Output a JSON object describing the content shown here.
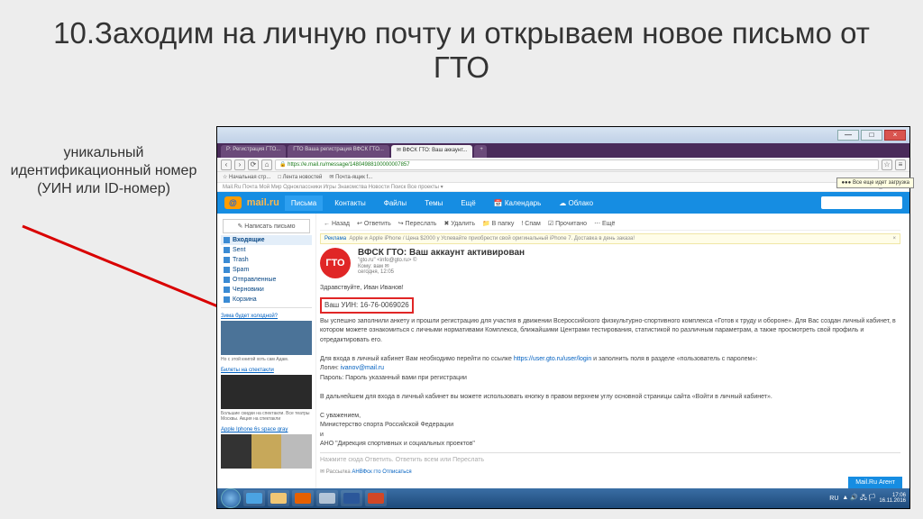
{
  "slide": {
    "title": "10.Заходим на личную почту и открываем новое письмо от ГТО",
    "caption": "уникальный идентификационный номер\n(УИН или ID-номер)"
  },
  "window": {
    "min": "—",
    "max": "□",
    "close": "×"
  },
  "browser": {
    "tabs": [
      "Р: Регистрация ГТО...",
      "ГТО Ваша регистрация ВФСК ГТО...",
      "✉ ВФСК ГТО: Ваш аккаунт...",
      "+"
    ],
    "url": "https://e.mail.ru/message/14804988100000007857",
    "nav": {
      "back": "‹",
      "fwd": "›",
      "reload": "⟳",
      "home": "⌂",
      "star": "☆",
      "menu": "≡"
    },
    "bookmarks": [
      "☆ Начальная стр...",
      "□ Лента новостей",
      "✉ Почта-ящик f..."
    ],
    "account": "t●●●f4@mail.ru ▾",
    "subbar_left": "Mail.Ru  Почта  Мой Мир  Одноклассники  Игры  Знакомства  Новости  Поиск  Все проекты ▾"
  },
  "mail": {
    "logo": "@",
    "logotext": "mail.ru",
    "tooltip": "●●● Все еще идет загрузка",
    "tabs": [
      "Письма",
      "Контакты",
      "Файлы",
      "Темы",
      "Ещё"
    ],
    "right": [
      "📅 Календарь",
      "☁ Облако"
    ],
    "compose": "✎ Написать письмо",
    "folders": [
      {
        "label": "Входящие",
        "act": true
      },
      {
        "label": "Sent"
      },
      {
        "label": "Trash"
      },
      {
        "label": "Spam"
      },
      {
        "label": "Отправленные"
      },
      {
        "label": "Черновики"
      },
      {
        "label": "Корзина"
      }
    ],
    "ads": [
      {
        "title": "Зима будет холодной?",
        "text": "Но с этой книгой хоть сам Адам.",
        "cls": ""
      },
      {
        "title": "Билеты на спектакли",
        "text": "Большие скидки на спектакли. Все театры Москвы. Акция на спектакли",
        "cls": "b2"
      },
      {
        "title": "Apple Iphone 6s space gray",
        "text": "",
        "cls": "b3"
      }
    ],
    "toolbar": [
      "← Назад",
      "↩ Ответить",
      "↪ Переслать",
      "✖ Удалить",
      "📁 В папку",
      "! Спам",
      "☑ Прочитано",
      "⋯ Ещё"
    ],
    "promo": {
      "link": "Реклама",
      "text": "Apple и Apple iPhone / Цена $2000 у Успевайте приобрести свой оригинальный iPhone 7. Доставка в день заказа!",
      "close": "×"
    },
    "avatar": "ГТО",
    "subject": "ВФСК ГТО: Ваш аккаунт активирован",
    "from_name": "\"gto.ru\" <info@gto.ru> ©",
    "from_to": "Кому: вам ✉",
    "time": "сегодня, 12:05",
    "greeting": "Здравствуйте, Иван Иванов!",
    "uin": "Ваш УИН: 16-76-0069026",
    "body1": "Вы успешно заполнили анкету и прошли регистрацию для участия в движении Всероссийского физкультурно-спортивного комплекса «Готов к труду и обороне». Для Вас создан личный кабинет, в котором можете ознакомиться с личными нормативами Комплекса, ближайшими Центрами тестирования, статистикой по различным параметрам, а также просмотреть свой профиль и отредактировать его.",
    "body2_pre": "Для входа в личный кабинет Вам необходимо перейти по ссылке ",
    "body2_link": "https://user.gto.ru/user/login",
    "body2_post": " и заполнить поля в разделе «пользователь с паролем»:",
    "login_l": "Логин: ",
    "login_v": "ivanov@mail.ru",
    "pass": "Пароль: Пароль указанный вами при регистрации",
    "body3": "В дальнейшем для входа в личный кабинет вы можете использовать кнопку в правом верхнем углу основной страницы сайта «Войти в личный кабинет».",
    "sign1": "С уважением,",
    "sign2": "Министерство спорта Российской Федерации",
    "sign3": "и",
    "sign4": "АНО \"Дирекция спортивных и социальных проектов\"",
    "reply_hint": "Нажмите сюда Ответить. Ответить всем или Переслать",
    "unsub_pre": "✉ Рассылка ",
    "unsub_link": "АНВФск гто",
    "unsub_post": " Отписаться",
    "agent": "Mail.Ru Агент"
  },
  "taskbar": {
    "lang": "RU",
    "time": "17:06",
    "date": "16.11.2016"
  }
}
